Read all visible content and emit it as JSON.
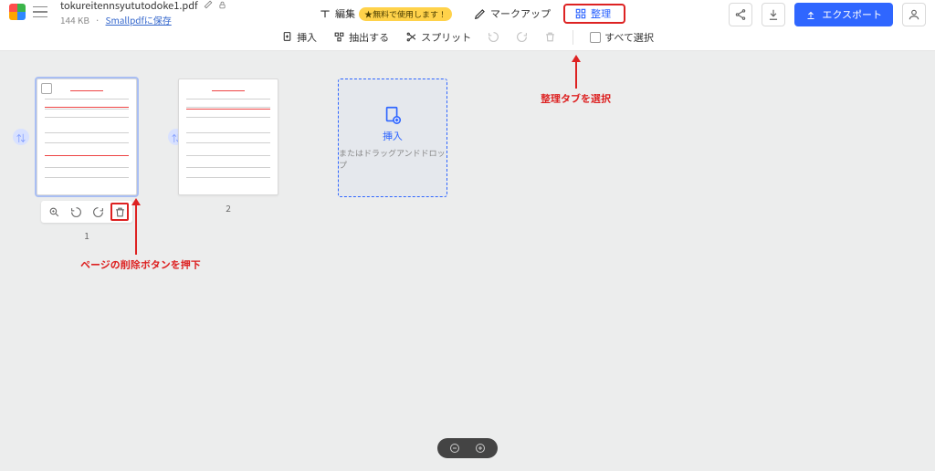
{
  "file": {
    "name": "tokureitennsyututodoke1.pdf",
    "size": "144 KB",
    "save_link": "Smallpdfに保存"
  },
  "top_tabs": {
    "edit": "編集",
    "free_badge": "★無料で使用します！",
    "markup": "マークアップ",
    "organize": "整理"
  },
  "export_label": "エクスポート",
  "toolbar": {
    "insert": "挿入",
    "extract": "抽出する",
    "split": "スプリット",
    "select_all": "すべて選択"
  },
  "dropzone": {
    "title": "挿入",
    "subtitle": "またはドラッグアンドドロップ"
  },
  "pages": [
    {
      "number": "1"
    },
    {
      "number": "2"
    }
  ],
  "annotations": {
    "organize_tab": "整理タブを選択",
    "delete_button": "ページの削除ボタンを押下"
  },
  "colors": {
    "accent": "#2f66ff",
    "callout": "#d22"
  }
}
